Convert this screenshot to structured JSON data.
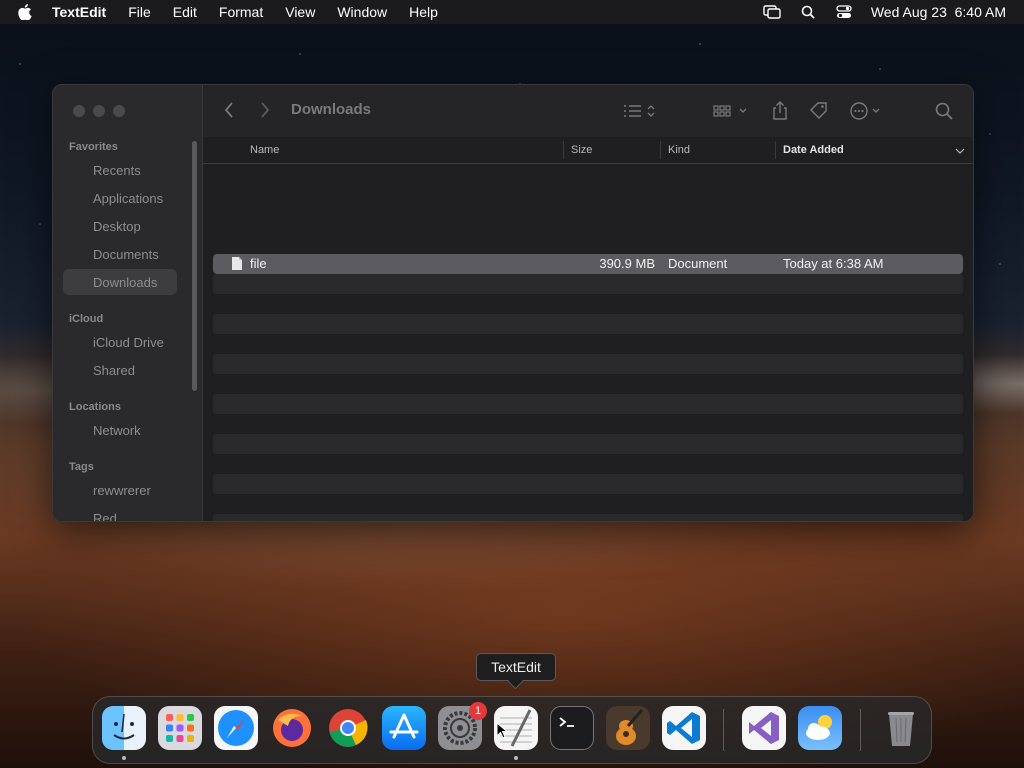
{
  "menubar": {
    "app_name": "TextEdit",
    "items": [
      "File",
      "Edit",
      "Format",
      "View",
      "Window",
      "Help"
    ],
    "clock": "Wed Aug 23  6:40 AM",
    "status_icons": [
      "screen-mirroring-icon",
      "spotlight-search-icon",
      "control-center-icon"
    ]
  },
  "finder": {
    "title": "Downloads",
    "sidebar": {
      "favorites_header": "Favorites",
      "favorites": [
        "Recents",
        "Applications",
        "Desktop",
        "Documents",
        "Downloads"
      ],
      "selected": "Downloads",
      "icloud_header": "iCloud",
      "icloud": [
        "iCloud Drive",
        "Shared"
      ],
      "locations_header": "Locations",
      "locations": [
        "Network"
      ],
      "tags_header": "Tags",
      "tags": [
        "rewwrerer",
        "Red"
      ]
    },
    "columns": {
      "name": "Name",
      "size": "Size",
      "kind": "Kind",
      "date_added": "Date Added"
    },
    "files": [
      {
        "name": "file",
        "size": "390.9 MB",
        "kind": "Document",
        "date_added": "Today at 6:38 AM"
      }
    ]
  },
  "dock": {
    "tooltip": "TextEdit",
    "apps": [
      "Finder",
      "Launchpad",
      "Safari",
      "Firefox",
      "Chrome",
      "App Store",
      "System Settings",
      "TextEdit",
      "Terminal",
      "GarageBand",
      "Visual Studio Code",
      "Visual Studio",
      "Weather",
      "Trash"
    ],
    "settings_badge": "1"
  }
}
